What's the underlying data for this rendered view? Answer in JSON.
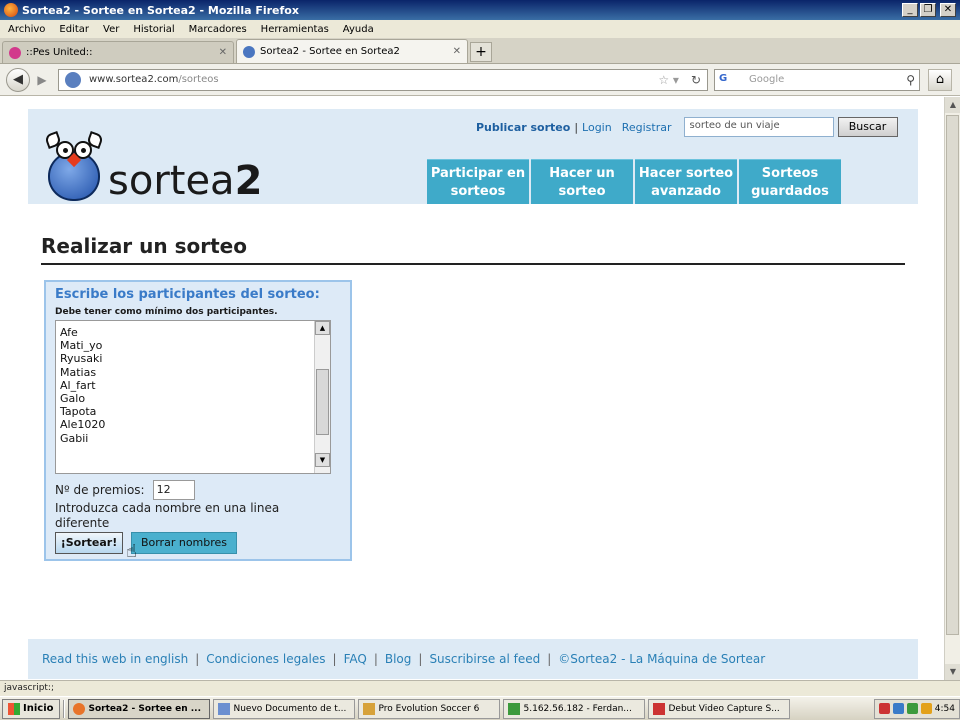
{
  "window": {
    "title": "Sortea2 - Sortee en Sortea2 - Mozilla Firefox"
  },
  "menu": [
    "Archivo",
    "Editar",
    "Ver",
    "Historial",
    "Marcadores",
    "Herramientas",
    "Ayuda"
  ],
  "tabs": [
    {
      "label": "::Pes United::"
    },
    {
      "label": "Sortea2 - Sortee en Sortea2"
    }
  ],
  "navbar": {
    "url_host": "www.sortea2.com",
    "url_path": "/sorteos",
    "search_placeholder": "Google",
    "search_engine": "G"
  },
  "site": {
    "logo_text": "sortea",
    "logo_num": "2",
    "toplinks": {
      "publish": "Publicar sorteo",
      "sep": "|",
      "login": "Login",
      "register": "Registrar",
      "search_value": "sorteo de un viaje",
      "search_button": "Buscar"
    },
    "nav": [
      {
        "line1": "Participar en",
        "line2": "sorteos"
      },
      {
        "line1": "Hacer un",
        "line2": "sorteo"
      },
      {
        "line1": "Hacer sorteo",
        "line2": "avanzado"
      },
      {
        "line1": "Sorteos",
        "line2": "guardados"
      }
    ],
    "page_title": "Realizar un sorteo",
    "form": {
      "heading": "Escribe los participantes del sorteo:",
      "subheading": "Debe tener como mínimo dos participantes.",
      "participants": [
        "Afe",
        "Mati_yo",
        "Ryusaki",
        "Matias",
        "Al_fart",
        "Galo",
        "Tapota",
        "Ale1020",
        "Gabii"
      ],
      "prizes_label": "Nº de premios:",
      "prizes_value": "12",
      "hint": "Introduzca cada nombre en una linea diferente",
      "submit": "¡Sortear!",
      "clear": "Borrar nombres"
    },
    "footer": [
      "Read this web in english",
      "Condiciones legales",
      "FAQ",
      "Blog",
      "Suscribirse al feed",
      "©Sortea2 - La Máquina de Sortear"
    ]
  },
  "statusbar": {
    "text": "javascript:;"
  },
  "taskbar": {
    "start": "Inicio",
    "tasks": [
      {
        "label": "Sortea2 - Sortee en ...",
        "color": "#e8742a"
      },
      {
        "label": "Nuevo Documento de t...",
        "color": "#6b8fd0"
      },
      {
        "label": "Pro Evolution Soccer 6",
        "color": "#d7a23a"
      },
      {
        "label": "5.162.56.182 - Ferdan...",
        "color": "#3c9a3c"
      },
      {
        "label": "Debut Video Capture S...",
        "color": "#c33"
      }
    ],
    "clock": "4:54"
  }
}
